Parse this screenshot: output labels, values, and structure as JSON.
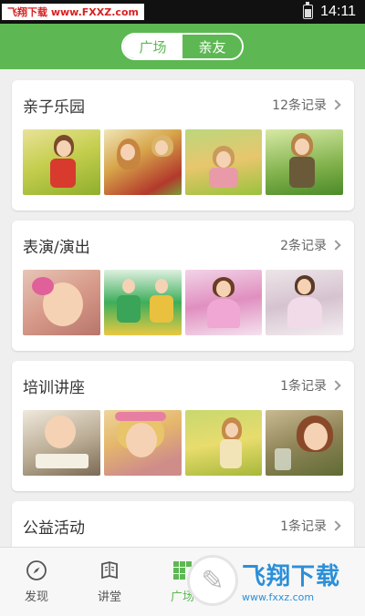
{
  "status_bar": {
    "time": "14:11",
    "watermark": "飞翔下载 www.FXXZ.com"
  },
  "header": {
    "tabs": [
      {
        "label": "广场",
        "active": true
      },
      {
        "label": "亲友",
        "active": false
      }
    ]
  },
  "sections": [
    {
      "title": "亲子乐园",
      "count": "12条记录"
    },
    {
      "title": "表演/演出",
      "count": "2条记录"
    },
    {
      "title": "培训讲座",
      "count": "1条记录"
    },
    {
      "title": "公益活动",
      "count": "1条记录"
    }
  ],
  "bottom_nav": {
    "items": [
      {
        "label": "发现",
        "icon": "compass-icon"
      },
      {
        "label": "讲堂",
        "icon": "book-icon"
      },
      {
        "label": "广场",
        "icon": "grid-icon",
        "active": true
      }
    ]
  },
  "watermark_bottom": {
    "title": "飞翔下载",
    "url": "www.fxxz.com"
  },
  "colors": {
    "accent": "#5db853",
    "watermark": "#2c8fd8"
  }
}
